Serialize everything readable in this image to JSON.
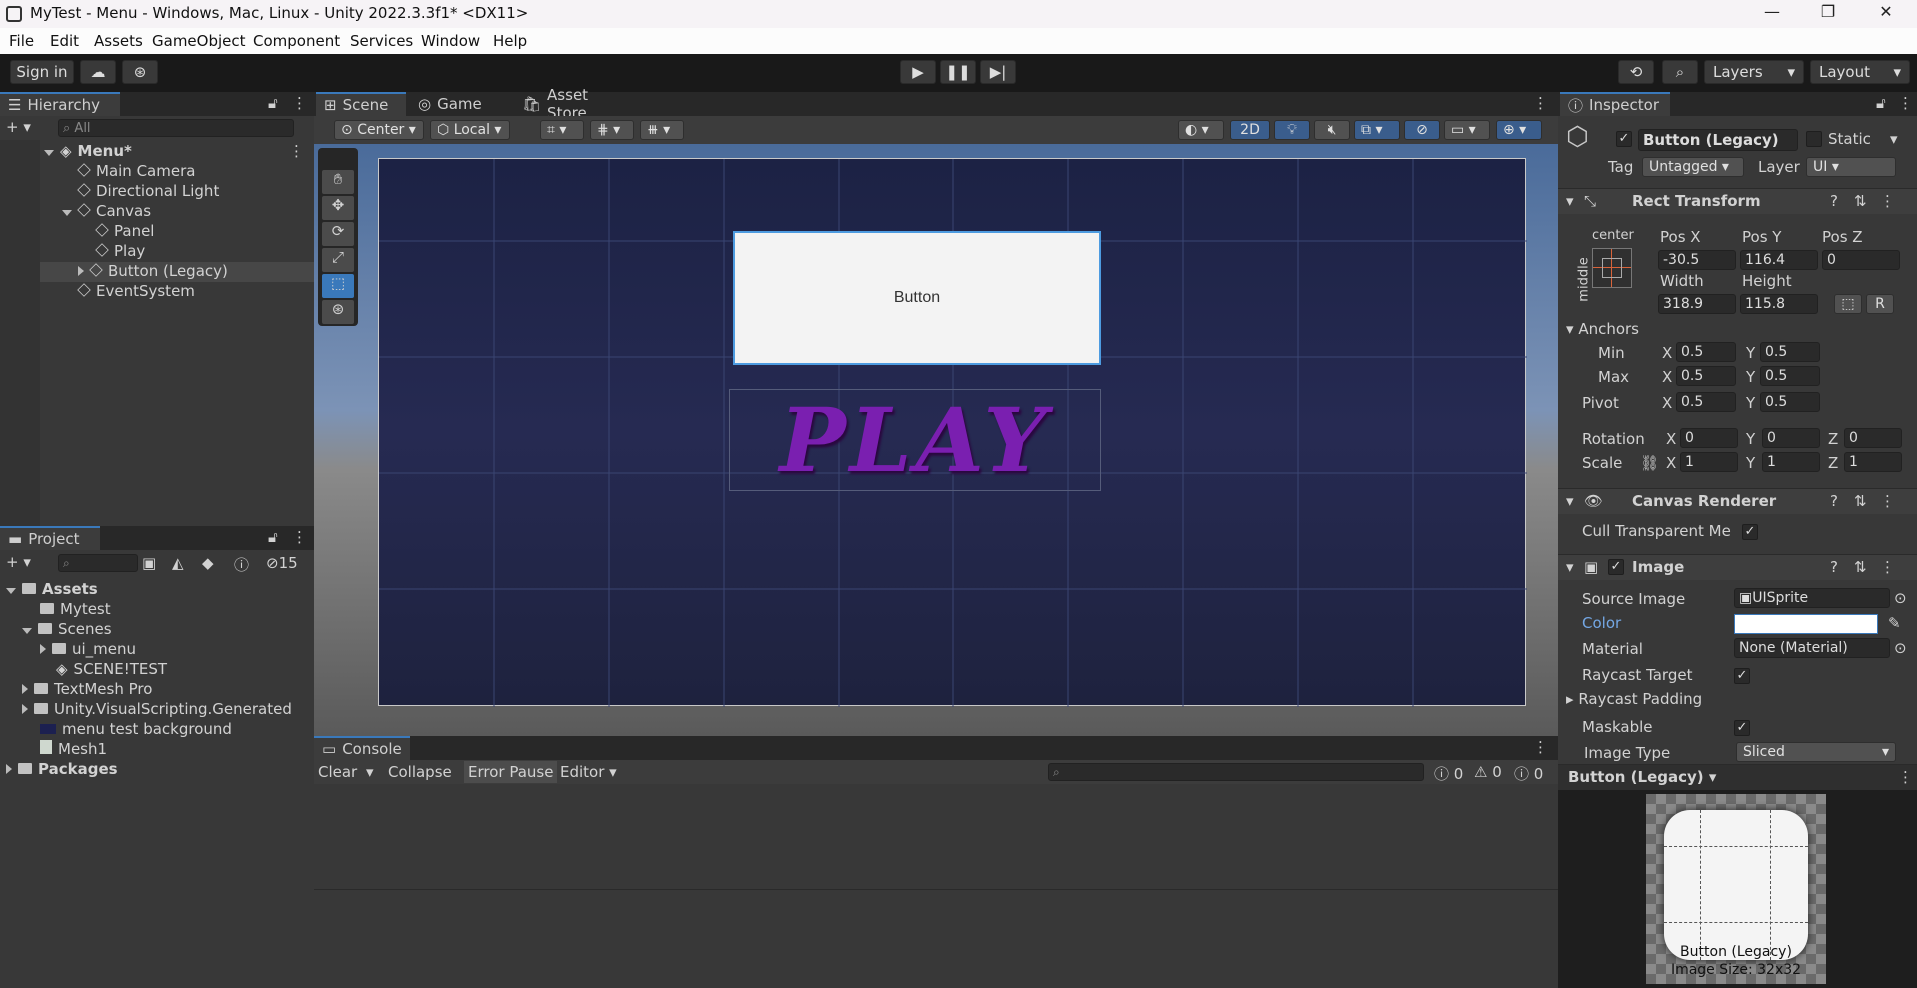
{
  "window": {
    "title": "MyTest - Menu - Windows, Mac, Linux - Unity 2022.3.3f1* <DX11>",
    "minimize": "—",
    "maximize": "❐",
    "close": "✕"
  },
  "menu": [
    "File",
    "Edit",
    "Assets",
    "GameObject",
    "Component",
    "Services",
    "Window",
    "Help"
  ],
  "toolbar": {
    "sign_in": "Sign in",
    "layers": "Layers",
    "layout": "Layout"
  },
  "hierarchy": {
    "tab": "Hierarchy",
    "search_placeholder": "All",
    "scene": "Menu*",
    "items": [
      "Main Camera",
      "Directional Light",
      "Canvas",
      "Panel",
      "Play",
      "Button (Legacy)",
      "EventSystem"
    ]
  },
  "project": {
    "tab": "Project",
    "hidden_count": "15",
    "assets": "Assets",
    "items": [
      "Mytest",
      "Scenes",
      "ui_menu",
      "SCENE!TEST",
      "TextMesh Pro",
      "Unity.VisualScripting.Generated",
      "menu test background",
      "Mesh1"
    ],
    "packages": "Packages"
  },
  "scene_view": {
    "tabs": [
      "Scene",
      "Game",
      "Asset Store"
    ],
    "pivot": "Center",
    "space": "Local",
    "mode_2d": "2D",
    "button_text": "Button",
    "play_text": "PLAY"
  },
  "console": {
    "tab": "Console",
    "clear": "Clear",
    "collapse": "Collapse",
    "error_pause": "Error Pause",
    "editor": "Editor",
    "log_count": "0",
    "warn_count": "0",
    "error_count": "0"
  },
  "inspector": {
    "tab": "Inspector",
    "object_name": "Button (Legacy)",
    "static_label": "Static",
    "tag_label": "Tag",
    "tag_value": "Untagged",
    "layer_label": "Layer",
    "layer_value": "UI",
    "rect_transform": {
      "title": "Rect Transform",
      "anchor_h": "center",
      "anchor_v": "middle",
      "pos_x_label": "Pos X",
      "pos_x": "-30.5",
      "pos_y_label": "Pos Y",
      "pos_y": "116.4",
      "pos_z_label": "Pos Z",
      "pos_z": "0",
      "width_label": "Width",
      "width": "318.9",
      "height_label": "Height",
      "height": "115.8",
      "r_btn": "R",
      "anchors_label": "Anchors",
      "min_label": "Min",
      "min_x": "0.5",
      "min_y": "0.5",
      "max_label": "Max",
      "max_x": "0.5",
      "max_y": "0.5",
      "pivot_label": "Pivot",
      "pivot_x": "0.5",
      "pivot_y": "0.5",
      "rotation_label": "Rotation",
      "rot_x": "0",
      "rot_y": "0",
      "rot_z": "0",
      "scale_label": "Scale",
      "scale_x": "1",
      "scale_y": "1",
      "scale_z": "1",
      "x": "X",
      "y": "Y",
      "z": "Z"
    },
    "canvas_renderer": {
      "title": "Canvas Renderer",
      "cull_label": "Cull Transparent Me"
    },
    "image": {
      "title": "Image",
      "source_label": "Source Image",
      "source_value": "UISprite",
      "color_label": "Color",
      "material_label": "Material",
      "material_value": "None (Material)",
      "raycast_label": "Raycast Target",
      "raycast_padding_label": "Raycast Padding",
      "maskable_label": "Maskable",
      "image_type_label": "Image Type",
      "image_type_value": "Sliced"
    },
    "preview": {
      "title": "Button (Legacy)",
      "caption": "Button (Legacy)",
      "size": "Image Size: 32x32"
    }
  },
  "colors": {
    "accent": "#3a79bb",
    "play_text": "#7a1fb0",
    "color_link": "#74a7e4"
  }
}
